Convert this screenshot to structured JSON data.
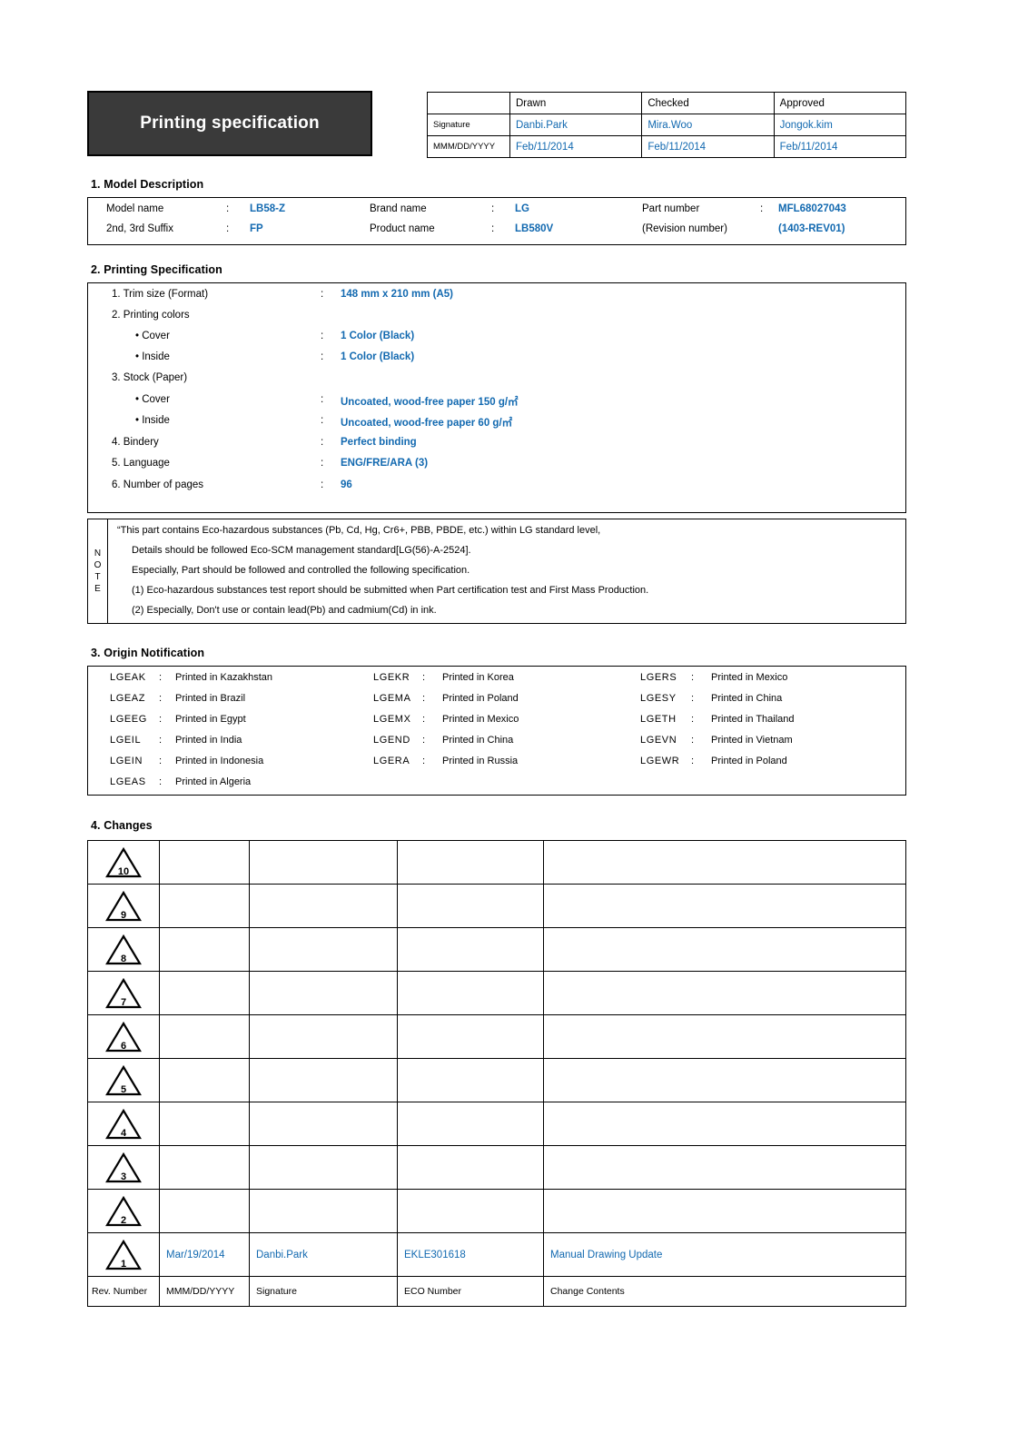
{
  "header": {
    "banner_title": "Printing specification",
    "signature_table": {
      "corner": "",
      "roles": [
        "Drawn",
        "Checked",
        "Approved"
      ],
      "rows": [
        {
          "label": "Signature",
          "values": [
            "Danbi.Park",
            "Mira.Woo",
            "Jongok.kim"
          ]
        },
        {
          "label": "MMM/DD/YYYY",
          "values": [
            "Feb/11/2014",
            "Feb/11/2014",
            "Feb/11/2014"
          ]
        }
      ]
    }
  },
  "model_description": {
    "section_title": "1. Model Description",
    "rows": [
      [
        {
          "label": "Model name",
          "colon": ":",
          "value": "LB58-Z"
        },
        {
          "label": "Brand name",
          "colon": ":",
          "value": "LG"
        },
        {
          "label": "Part number",
          "colon": ":",
          "value": "MFL68027043"
        }
      ],
      [
        {
          "label": "2nd, 3rd Suffix",
          "colon": ":",
          "value": "FP"
        },
        {
          "label": "Product name",
          "colon": ":",
          "value": "LB580V"
        },
        {
          "label": "(Revision number)",
          "colon": "",
          "value": "(1403-REV01)"
        }
      ]
    ]
  },
  "printing_specification": {
    "section_title": "2. Printing Specification",
    "lines": [
      {
        "indent": 0,
        "label": "1. Trim size (Format)",
        "colon": ":",
        "value": "148 mm x 210 mm (A5)"
      },
      {
        "indent": 0,
        "label": "2. Printing colors",
        "colon": "",
        "value": ""
      },
      {
        "indent": 1,
        "label": "• Cover",
        "colon": ":",
        "value": "1 Color (Black)"
      },
      {
        "indent": 1,
        "label": "• Inside",
        "colon": ":",
        "value": "1 Color (Black)"
      },
      {
        "indent": 0,
        "label": "3. Stock (Paper)",
        "colon": "",
        "value": ""
      },
      {
        "indent": 1,
        "label": "• Cover",
        "colon": ":",
        "value": "Uncoated, wood-free paper 150 g/㎡"
      },
      {
        "indent": 1,
        "label": "• Inside",
        "colon": ":",
        "value": "Uncoated, wood-free paper 60 g/㎡"
      },
      {
        "indent": 0,
        "label": "4. Bindery",
        "colon": ":",
        "value": "Perfect binding"
      },
      {
        "indent": 0,
        "label": "5. Language",
        "colon": ":",
        "value": "ENG/FRE/ARA (3)"
      },
      {
        "indent": 0,
        "label": "6. Number of pages",
        "colon": ":",
        "value": "96"
      }
    ]
  },
  "note": {
    "vertical_label": [
      "N",
      "O",
      "T",
      "E"
    ],
    "lines": [
      {
        "indent": 0,
        "text": "“This part contains Eco-hazardous substances (Pb, Cd, Hg, Cr6+, PBB, PBDE, etc.) within LG standard level,"
      },
      {
        "indent": 1,
        "text": "Details should be followed Eco-SCM management standard[LG(56)-A-2524]."
      },
      {
        "indent": 1,
        "text": "Especially, Part should be followed and controlled the following specification."
      },
      {
        "indent": 1,
        "text": "(1) Eco-hazardous substances test report should be submitted when Part certification test and First Mass Production."
      },
      {
        "indent": 1,
        "text": "(2) Especially, Don't use or contain lead(Pb) and cadmium(Cd) in ink."
      }
    ]
  },
  "origin_notification": {
    "section_title": "3. Origin Notification",
    "columns": [
      [
        {
          "code": "LGEAK",
          "colon": ":",
          "country": "Printed in Kazakhstan"
        },
        {
          "code": "LGEAZ",
          "colon": ":",
          "country": "Printed in Brazil"
        },
        {
          "code": "LGEEG",
          "colon": ":",
          "country": "Printed in Egypt"
        },
        {
          "code": "LGEIL",
          "colon": ":",
          "country": "Printed in India"
        },
        {
          "code": "LGEIN",
          "colon": ":",
          "country": "Printed in Indonesia"
        },
        {
          "code": "LGEAS",
          "colon": ":",
          "country": "Printed in Algeria"
        }
      ],
      [
        {
          "code": "LGEKR",
          "colon": ":",
          "country": "Printed in Korea"
        },
        {
          "code": "LGEMA",
          "colon": ":",
          "country": "Printed in Poland"
        },
        {
          "code": "LGEMX",
          "colon": ":",
          "country": "Printed in Mexico"
        },
        {
          "code": "LGEND",
          "colon": ":",
          "country": "Printed in China"
        },
        {
          "code": "LGERA",
          "colon": ":",
          "country": "Printed in Russia"
        }
      ],
      [
        {
          "code": "LGERS",
          "colon": ":",
          "country": "Printed in Mexico"
        },
        {
          "code": "LGESY",
          "colon": ":",
          "country": "Printed in China"
        },
        {
          "code": "LGETH",
          "colon": ":",
          "country": "Printed in Thailand"
        },
        {
          "code": "LGEVN",
          "colon": ":",
          "country": "Printed in Vietnam"
        },
        {
          "code": "LGEWR",
          "colon": ":",
          "country": "Printed in Poland"
        }
      ]
    ]
  },
  "changes": {
    "section_title": "4. Changes",
    "rows": [
      {
        "rev": "10",
        "date": "",
        "signature": "",
        "eco_number": "",
        "change_contents": ""
      },
      {
        "rev": "9",
        "date": "",
        "signature": "",
        "eco_number": "",
        "change_contents": ""
      },
      {
        "rev": "8",
        "date": "",
        "signature": "",
        "eco_number": "",
        "change_contents": ""
      },
      {
        "rev": "7",
        "date": "",
        "signature": "",
        "eco_number": "",
        "change_contents": ""
      },
      {
        "rev": "6",
        "date": "",
        "signature": "",
        "eco_number": "",
        "change_contents": ""
      },
      {
        "rev": "5",
        "date": "",
        "signature": "",
        "eco_number": "",
        "change_contents": ""
      },
      {
        "rev": "4",
        "date": "",
        "signature": "",
        "eco_number": "",
        "change_contents": ""
      },
      {
        "rev": "3",
        "date": "",
        "signature": "",
        "eco_number": "",
        "change_contents": ""
      },
      {
        "rev": "2",
        "date": "",
        "signature": "",
        "eco_number": "",
        "change_contents": ""
      },
      {
        "rev": "1",
        "date": "Mar/19/2014",
        "signature": "Danbi.Park",
        "eco_number": "EKLE301618",
        "change_contents": "Manual Drawing Update"
      }
    ],
    "footer": {
      "rev": "Rev. Number",
      "date": "MMM/DD/YYYY",
      "signature": "Signature",
      "eco_number": "ECO Number",
      "change_contents": "Change Contents"
    }
  },
  "colors": {
    "accent_blue": "#1269b0",
    "banner_bg": "#3a3a3a",
    "border": "#000000"
  }
}
